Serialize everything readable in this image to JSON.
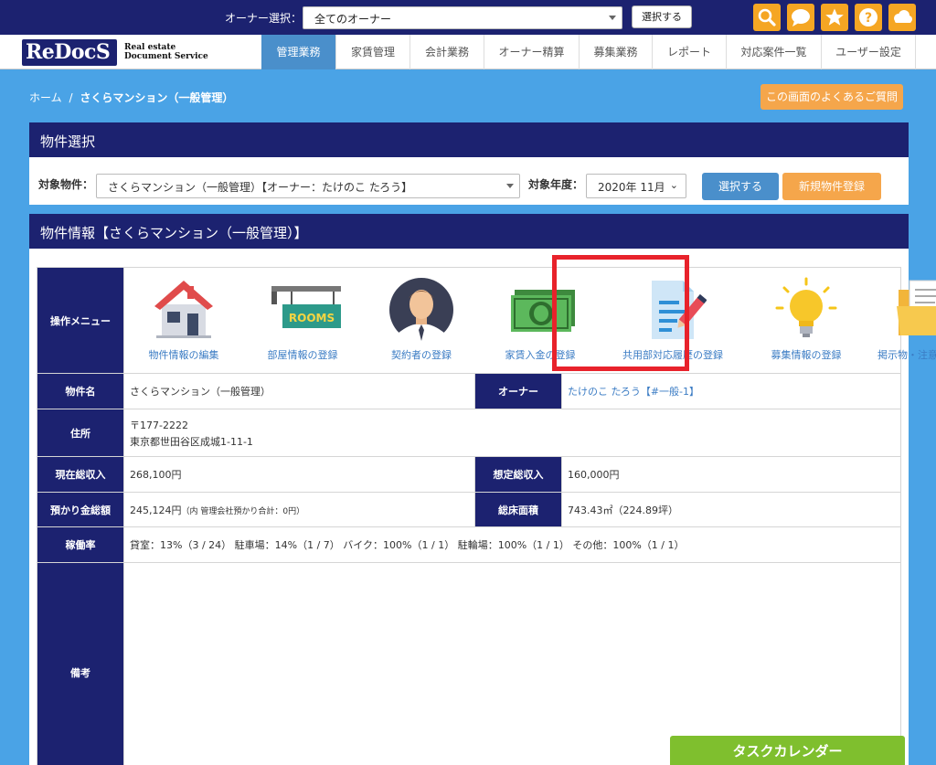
{
  "topbar": {
    "owner_label": "オーナー選択：",
    "owner_selected": "全てのオーナー",
    "select_button": "選択する",
    "icons": [
      "search-icon",
      "chat-icon",
      "star-icon",
      "help-icon",
      "cloud-icon"
    ]
  },
  "logo": {
    "mark": "ReDocS",
    "sub1": "Real estate",
    "sub2": "Document Service"
  },
  "nav": {
    "items": [
      {
        "label": "管理業務",
        "active": true
      },
      {
        "label": "家賃管理"
      },
      {
        "label": "会計業務"
      },
      {
        "label": "オーナー精算"
      },
      {
        "label": "募集業務"
      },
      {
        "label": "レポート"
      },
      {
        "label": "対応案件一覧"
      },
      {
        "label": "ユーザー設定"
      }
    ]
  },
  "breadcrumb": {
    "home": "ホーム",
    "separator": "/",
    "current": "さくらマンション（一般管理）"
  },
  "faq_button": "この画面のよくあるご質問",
  "property_select": {
    "header": "物件選択",
    "target_label": "対象物件：",
    "target_value": "さくらマンション（一般管理）【オーナー：たけのこ たろう】",
    "year_label": "対象年度：",
    "year_value": "2020年 11月",
    "select_button": "選択する",
    "new_button": "新規物件登録"
  },
  "property_info": {
    "header": "物件情報【さくらマンション（一般管理）】",
    "menu_label": "操作メニュー",
    "menu": [
      {
        "label": "物件情報の編集",
        "icon": "house-icon"
      },
      {
        "label": "部屋情報の登録",
        "icon": "rooms-sign-icon"
      },
      {
        "label": "契約者の登録",
        "icon": "person-icon"
      },
      {
        "label": "家賃入金の登録",
        "icon": "money-icon"
      },
      {
        "label": "共用部対応履歴の登録",
        "icon": "document-pen-icon"
      },
      {
        "label": "募集情報の登録",
        "icon": "lightbulb-icon"
      },
      {
        "label": "掲示物・注意文の出力",
        "icon": "folder-icon"
      }
    ],
    "rows": {
      "name_label": "物件名",
      "name_value": "さくらマンション（一般管理）",
      "owner_label": "オーナー",
      "owner_value": "たけのこ たろう【#一般-1】",
      "address_label": "住所",
      "address_zip": "〒177-2222",
      "address_line": "東京都世田谷区成城1-11-1",
      "income_label": "現在総収入",
      "income_value": "268,100円",
      "expected_label": "想定総収入",
      "expected_value": "160,000円",
      "deposit_label": "預かり金総額",
      "deposit_value": "245,124円",
      "deposit_note": "（内 管理会社預かり合計：0円）",
      "floor_label": "総床面積",
      "floor_value": "743.43㎡（224.89坪）",
      "occupancy_label": "稼働率",
      "occupancy_value": "貸室：13%（3 / 24） 駐車場：14%（1 / 7） バイク：100%（1 / 1） 駐輪場：100%（1 / 1） その他：100%（1 / 1）",
      "notes_label": "備考",
      "notes_value": ""
    }
  },
  "task_calendar": "タスクカレンダー",
  "colors": {
    "navy": "#1c2270",
    "sky": "#4aa3e6",
    "orange": "#f5a64b",
    "green": "#7fbf2e",
    "highlight": "#e8222b"
  }
}
